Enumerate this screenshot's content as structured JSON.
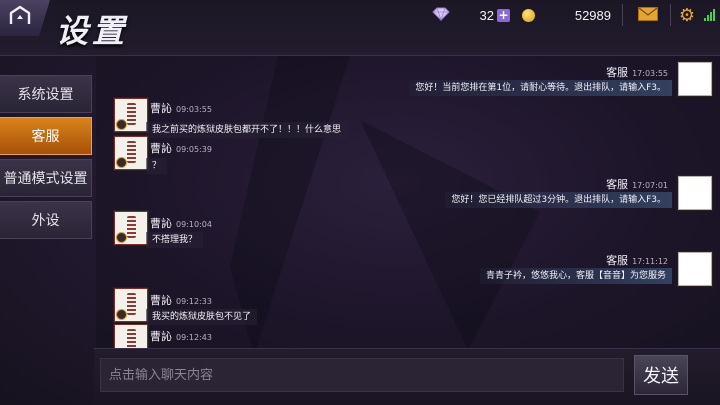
{
  "header": {
    "title": "设置",
    "gems": "32",
    "gold": "52989",
    "icons": [
      "back-icon",
      "diamond-icon",
      "plus-icon",
      "gold-coin-icon",
      "mail-icon",
      "gear-icon",
      "signal-icon"
    ]
  },
  "sidebar": {
    "items": [
      {
        "label": "系统设置",
        "active": false
      },
      {
        "label": "客服",
        "active": true
      },
      {
        "label": "普通模式设置",
        "active": false
      },
      {
        "label": "外设",
        "active": false
      }
    ]
  },
  "chat": {
    "messages": [
      {
        "side": "out",
        "name": "客服",
        "time": "17:03:55",
        "text": "您好！当前您排在第1位，请耐心等待。退出排队，请输入F3。"
      },
      {
        "side": "in",
        "name": "曹訫",
        "time": "09:03:55",
        "text": "我之前买的炼狱皮肤包都开不了！！！什么意思"
      },
      {
        "side": "in",
        "name": "曹訫",
        "time": "09:05:39",
        "text": "？"
      },
      {
        "side": "out",
        "name": "客服",
        "time": "17:07:01",
        "text": "您好！您已经排队超过3分钟。退出排队，请输入F3。"
      },
      {
        "side": "in",
        "name": "曹訫",
        "time": "09:10:04",
        "text": "不搭理我？"
      },
      {
        "side": "out",
        "name": "客服",
        "time": "17:11:12",
        "text": "青青子衿，悠悠我心，客服【音音】为您服务"
      },
      {
        "side": "in",
        "name": "曹訫",
        "time": "09:12:33",
        "text": "我买的炼狱皮肤包不见了"
      },
      {
        "side": "in",
        "name": "曹訫",
        "time": "09:12:43",
        "text": ""
      }
    ]
  },
  "input": {
    "placeholder": "点击输入聊天内容",
    "value": "",
    "send_label": "发送"
  },
  "colors": {
    "active_tab": "#d9831b",
    "background": "#241a33",
    "signal": "#46d24a",
    "gold": "#e4a630"
  }
}
